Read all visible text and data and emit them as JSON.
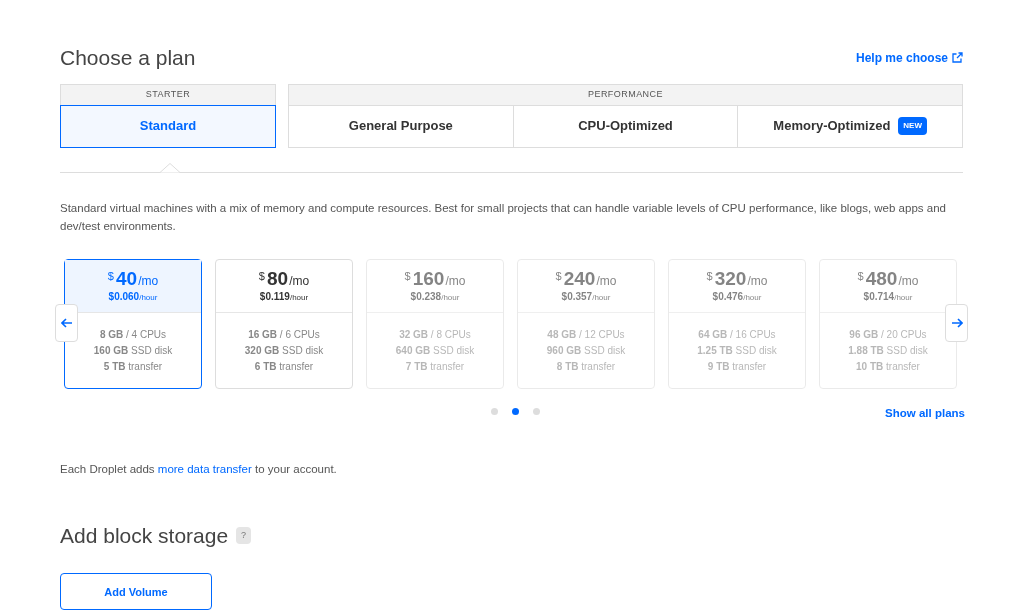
{
  "heading": "Choose a plan",
  "help_link": "Help me choose",
  "tab_groups": [
    {
      "label": "STARTER",
      "tabs": [
        {
          "label": "Standard",
          "selected": true
        }
      ]
    },
    {
      "label": "PERFORMANCE",
      "tabs": [
        {
          "label": "General Purpose",
          "selected": false
        },
        {
          "label": "CPU-Optimized",
          "selected": false
        },
        {
          "label": "Memory-Optimized",
          "selected": false,
          "badge": "NEW"
        }
      ]
    }
  ],
  "description": "Standard virtual machines with a mix of memory and compute resources. Best for small projects that can handle variable levels of CPU performance, like blogs, web apps and dev/test environments.",
  "plans": [
    {
      "currency": "$",
      "price": "40",
      "period": "/mo",
      "hourly": "$0.060",
      "hourly_unit": "/hour",
      "specs": [
        "**8 GB** / 4 CPUs",
        "**160 GB** SSD disk",
        "**5 TB** transfer"
      ],
      "selected": true,
      "dimmed": false
    },
    {
      "currency": "$",
      "price": "80",
      "period": "/mo",
      "hourly": "$0.119",
      "hourly_unit": "/hour",
      "specs": [
        "**16 GB** / 6 CPUs",
        "**320 GB** SSD disk",
        "**6 TB** transfer"
      ],
      "selected": false,
      "dimmed": false
    },
    {
      "currency": "$",
      "price": "160",
      "period": "/mo",
      "hourly": "$0.238",
      "hourly_unit": "/hour",
      "specs": [
        "**32 GB** / 8 CPUs",
        "**640 GB** SSD disk",
        "**7 TB** transfer"
      ],
      "selected": false,
      "dimmed": true
    },
    {
      "currency": "$",
      "price": "240",
      "period": "/mo",
      "hourly": "$0.357",
      "hourly_unit": "/hour",
      "specs": [
        "**48 GB** / 12 CPUs",
        "**960 GB** SSD disk",
        "**8 TB** transfer"
      ],
      "selected": false,
      "dimmed": true
    },
    {
      "currency": "$",
      "price": "320",
      "period": "/mo",
      "hourly": "$0.476",
      "hourly_unit": "/hour",
      "specs": [
        "**64 GB** / 16 CPUs",
        "**1.25 TB** SSD disk",
        "**9 TB** transfer"
      ],
      "selected": false,
      "dimmed": true
    },
    {
      "currency": "$",
      "price": "480",
      "period": "/mo",
      "hourly": "$0.714",
      "hourly_unit": "/hour",
      "specs": [
        "**96 GB** / 20 CPUs",
        "**1.88 TB** SSD disk",
        "**10 TB** transfer"
      ],
      "selected": false,
      "dimmed": true
    }
  ],
  "pager": [
    {
      "selected": false
    },
    {
      "selected": true
    },
    {
      "selected": false
    }
  ],
  "show_all": "Show all plans",
  "transfer_note": {
    "before": "Each Droplet adds",
    "link": "more data transfer",
    "after": "to your account."
  },
  "storage_heading": "Add block storage",
  "storage_help": "?",
  "add_volume": "Add Volume"
}
